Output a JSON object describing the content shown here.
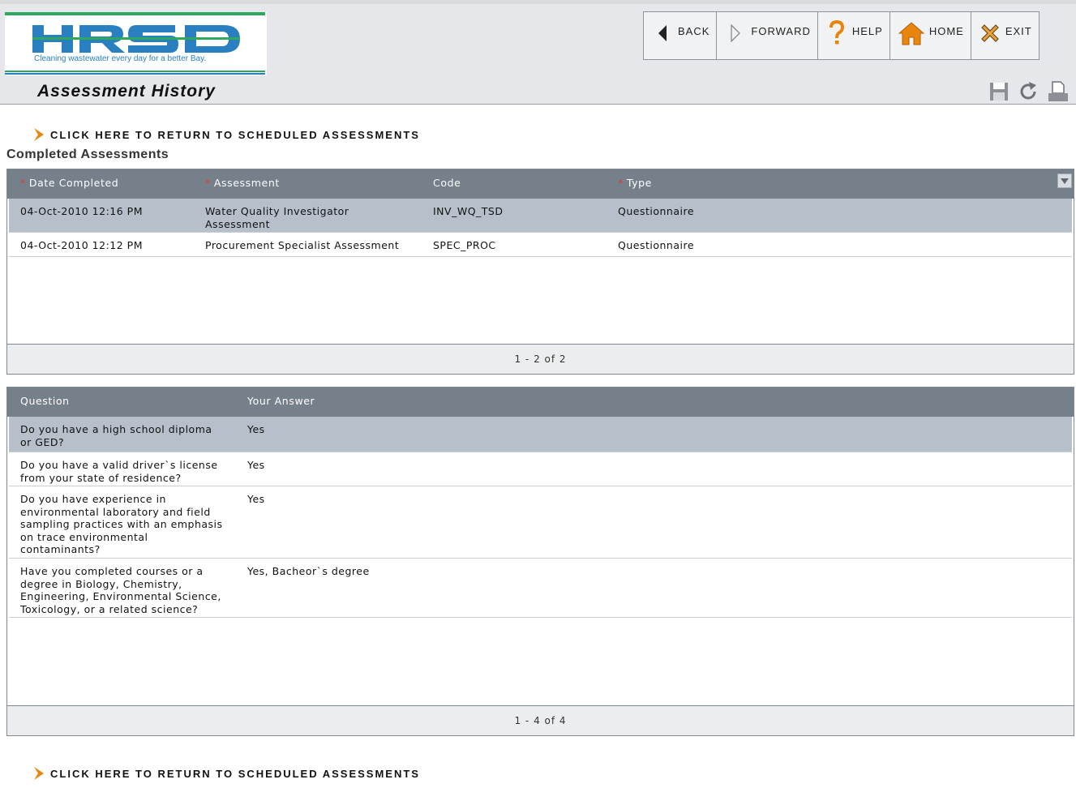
{
  "logo": {
    "text": "HRSD",
    "tagline": "Cleaning wastewater every day for a better Bay."
  },
  "nav": {
    "back": "BACK",
    "forward": "FORWARD",
    "help": "HELP",
    "home": "HOME",
    "exit": "EXIT"
  },
  "page_title": "Assessment History",
  "return_link": "CLICK HERE TO RETURN TO SCHEDULED ASSESSMENTS",
  "completed": {
    "title": "Completed Assessments",
    "headers": {
      "date": "Date Completed",
      "assessment": "Assessment",
      "code": "Code",
      "type": "Type"
    },
    "rows": [
      {
        "date": "04-Oct-2010 12:16 PM",
        "assessment_line1": "Water Quality Investigator",
        "assessment_line2": "Assessment",
        "code": "INV_WQ_TSD",
        "type": "Questionnaire"
      },
      {
        "date": "04-Oct-2010 12:12 PM",
        "assessment_line1": "Procurement Specialist Assessment",
        "assessment_line2": "",
        "code": "SPEC_PROC",
        "type": "Questionnaire"
      }
    ],
    "pager": "1 - 2 of 2"
  },
  "answers": {
    "headers": {
      "question": "Question",
      "answer": "Your Answer"
    },
    "rows": [
      {
        "q1": "Do you have a high school diploma",
        "q2": "or GED?",
        "q3": "",
        "q4": "",
        "q5": "",
        "answer": "Yes"
      },
      {
        "q1": "Do you have a valid driver`s license",
        "q2": "from your state of residence?",
        "q3": "",
        "q4": "",
        "q5": "",
        "answer": "Yes"
      },
      {
        "q1": "Do you have experience in",
        "q2": "environmental laboratory and field",
        "q3": "sampling practices with an emphasis",
        "q4": "on trace environmental",
        "q5": "contaminants?",
        "answer": "Yes"
      },
      {
        "q1": "Have you completed courses or a",
        "q2": "degree in Biology, Chemistry,",
        "q3": "Engineering, Environmental Science,",
        "q4": "Toxicology, or a related science?",
        "q5": "",
        "answer": "Yes, Bacheor`s degree"
      }
    ],
    "pager": "1 - 4 of 4"
  }
}
